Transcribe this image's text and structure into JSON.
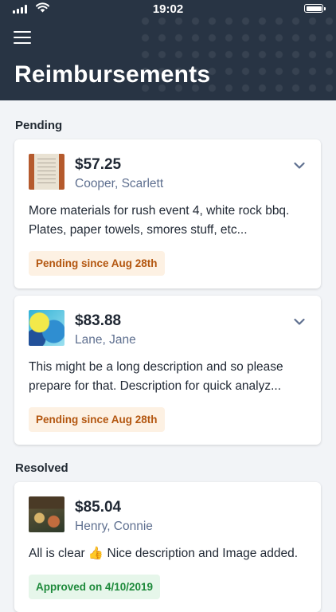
{
  "status_bar": {
    "time": "19:02"
  },
  "header": {
    "title": "Reimbursements",
    "menu_icon": "hamburger-menu-icon"
  },
  "sections": {
    "pending": {
      "label": "Pending"
    },
    "resolved": {
      "label": "Resolved"
    }
  },
  "cards": [
    {
      "amount": "$57.25",
      "name": "Cooper, Scarlett",
      "description": "More materials for rush event 4, white rock bbq. Plates, paper towels, smores stuff, etc...",
      "status": "Pending since Aug 28th",
      "status_type": "pending",
      "thumbnail": "receipt-image"
    },
    {
      "amount": "$83.88",
      "name": "Lane, Jane",
      "description": "This might be a long description and so please prepare for that. Description for quick analyz...",
      "status": "Pending since Aug 28th",
      "status_type": "pending",
      "thumbnail": "painting-image"
    },
    {
      "amount": "$85.04",
      "name": "Henry, Connie",
      "description": "All is clear 👍 Nice description and Image added.",
      "status": "Approved on 4/10/2019",
      "status_type": "approved",
      "thumbnail": "restaurant-image"
    }
  ],
  "colors": {
    "header_bg": "#283444",
    "pending_text": "#b3560f",
    "pending_bg": "#fdf1e3",
    "approved_text": "#1e8a3b",
    "approved_bg": "#e6f6ea"
  }
}
